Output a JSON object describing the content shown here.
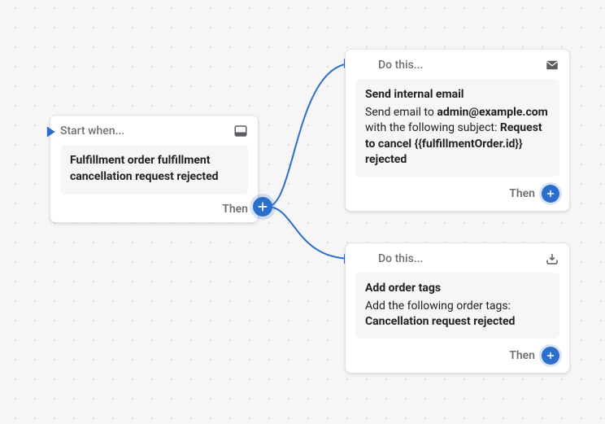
{
  "trigger": {
    "header_label": "Start when...",
    "title": "Fulfillment order fulfillment cancellation request rejected",
    "then_label": "Then"
  },
  "actions": [
    {
      "header_label": "Do this...",
      "title": "Send internal email",
      "desc_prefix": "Send email to ",
      "email": "admin@example.com",
      "desc_mid": " with the following subject: ",
      "subject": "Request to cancel {{fulfillmentOrder.id}} rejected",
      "then_label": "Then"
    },
    {
      "header_label": "Do this...",
      "title": "Add order tags",
      "desc_prefix": "Add the following order tags: ",
      "tags": "Cancellation request rejected",
      "then_label": "Then"
    }
  ]
}
